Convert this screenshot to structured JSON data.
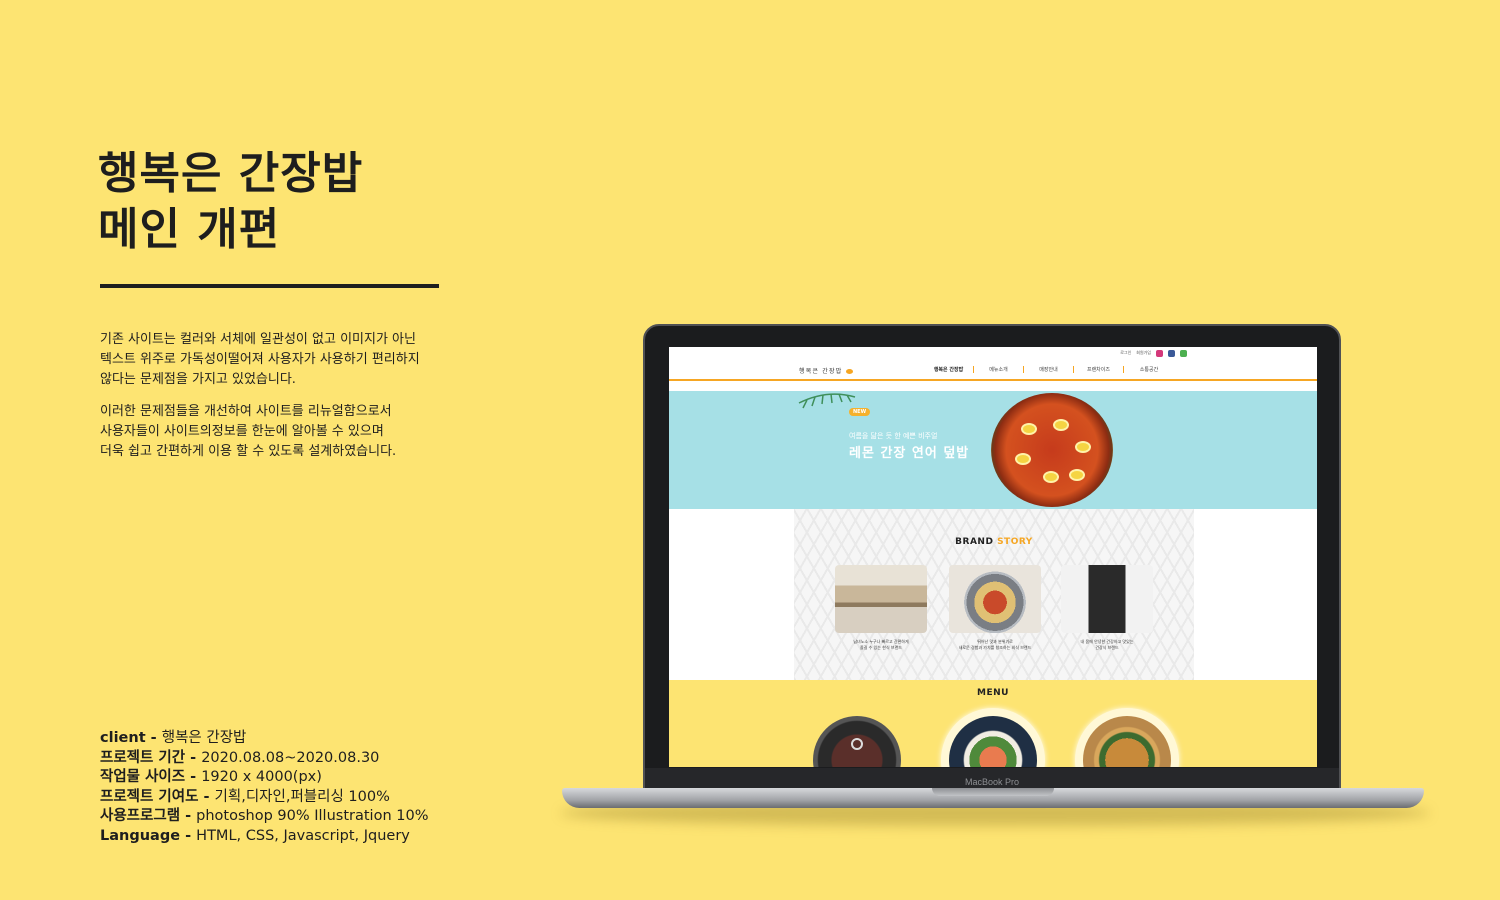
{
  "project": {
    "title_lines": [
      "행복은 간장밥",
      "메인 개편"
    ],
    "description": [
      " 기존 사이트는 컬러와 서체에 일관성이 없고 이미지가 아닌\n텍스트 위주로 가독성이떨어져 사용자가 사용하기 편리하지\n않다는 문제점을 가지고 있었습니다.",
      "이러한 문제점들을 개선하여 사이트를 리뉴얼함으로서\n사용자들이 사이트의정보를  한눈에 알아볼 수 있으며\n더욱  쉽고  간편하게 이용 할 수 있도록 설계하였습니다."
    ],
    "info": [
      {
        "label": "client - ",
        "value": "행복은 간장밥"
      },
      {
        "label": "프로젝트 기간 - ",
        "value": "2020.08.08~2020.08.30"
      },
      {
        "label": "작업물 사이즈 - ",
        "value": "1920 x  4000(px)"
      },
      {
        "label": "프로젝트 기여도 - ",
        "value": "기획,디자인,퍼블리싱 100%"
      },
      {
        "label": "사용프로그램 - ",
        "value": "photoshop 90%  Illustration  10%"
      },
      {
        "label": "Language - ",
        "value": "HTML, CSS, Javascript, Jquery"
      }
    ]
  },
  "laptop": {
    "model_label": "MacBook Pro"
  },
  "site": {
    "topbar": [
      "로그인",
      "회원가입"
    ],
    "logo": "행복은 간장밥",
    "nav": [
      "행복은 간장밥",
      "메뉴소개",
      "매장안내",
      "프랜차이즈",
      "소통공간"
    ],
    "hero": {
      "badge": "NEW",
      "sub": "여름을 닮은 듯 한 예쁜 비주얼",
      "title": "레몬 간장 연어 덮밥"
    },
    "brand": {
      "title_a": "BRAND",
      "title_b": "STORY",
      "cards": [
        {
          "caption": "남녀노소 누구나 빠르고 간편하게\n즐길 수 있는 한식 브랜드"
        },
        {
          "caption": "뛰어난 맛과 분위기로\n새로운 경험과 가치를 창조하는 외식 브랜드"
        },
        {
          "caption": "내 몸에 안녕한 건강하고 맛있는\n건강식 브랜드"
        }
      ]
    },
    "menu": {
      "title": "MENU"
    }
  },
  "colors": {
    "background": "#fde472",
    "accent": "#f6a623",
    "hero_bg": "#a6e0e6",
    "text": "#1e1e1e"
  }
}
